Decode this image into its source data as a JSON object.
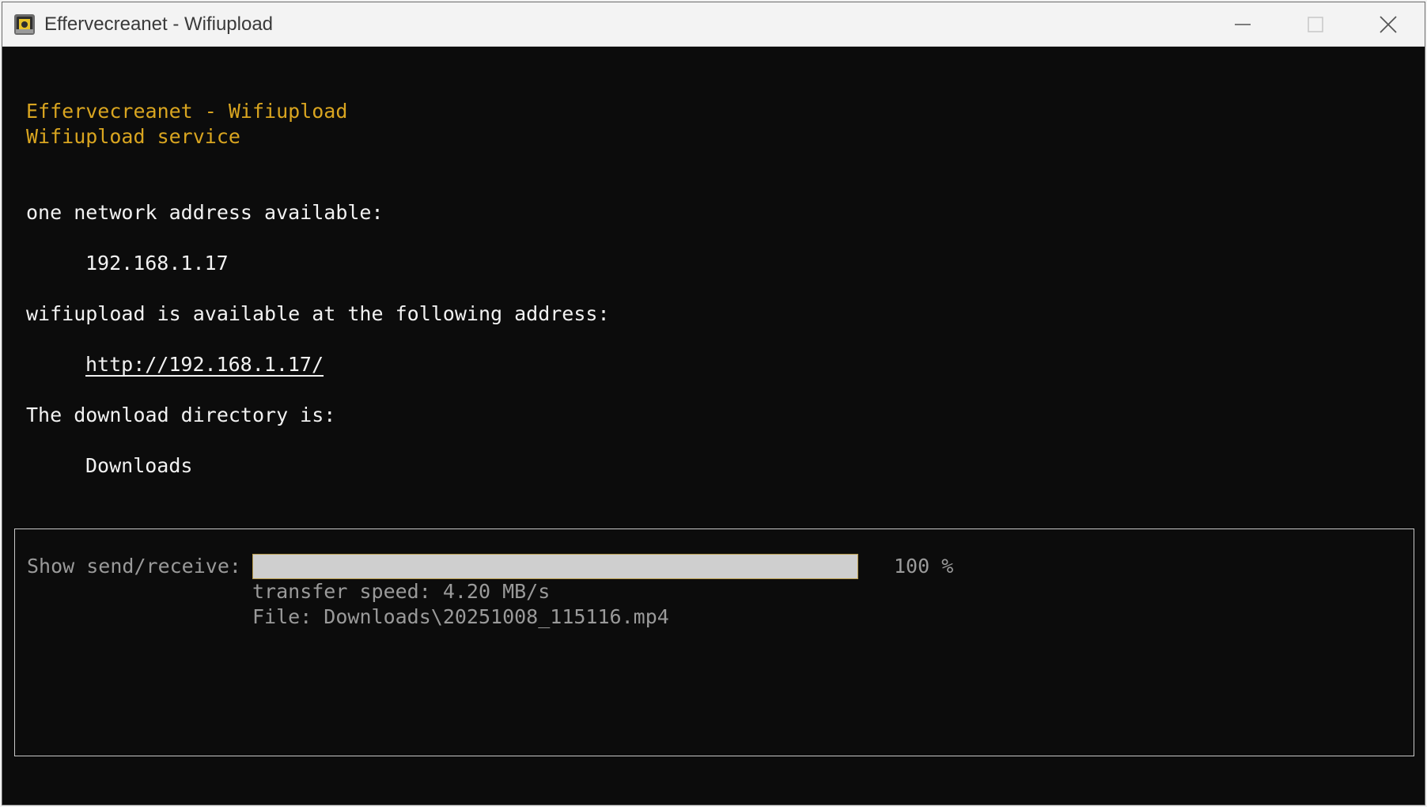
{
  "window": {
    "title": "Effervecreanet - Wifiupload",
    "icon": "app-icon",
    "controls": [
      "minimize-icon",
      "maximize-icon",
      "close-icon"
    ]
  },
  "console": {
    "header_line1": "Effervecreanet - Wifiupload",
    "header_line2": "Wifiupload service",
    "network_label": "one network address available:",
    "network_address": "192.168.1.17",
    "available_label": "wifiupload is available at the following address:",
    "url": "http://192.168.1.17/",
    "download_dir_label": "The download directory is:",
    "download_dir": "Downloads"
  },
  "transfer": {
    "show_label": "Show send/receive:",
    "progress_percent": 100,
    "progress_text": "100 %",
    "speed_text": "transfer speed: 4.20 MB/s",
    "file_text": "File: Downloads\\20251008_115116.mp4"
  },
  "colors": {
    "accent_yellow": "#d9a520",
    "console_bg": "#0c0c0c",
    "text_white": "#f2f2f2",
    "text_gray": "#9a9a9a",
    "progress_fill": "#cfcfcf"
  }
}
